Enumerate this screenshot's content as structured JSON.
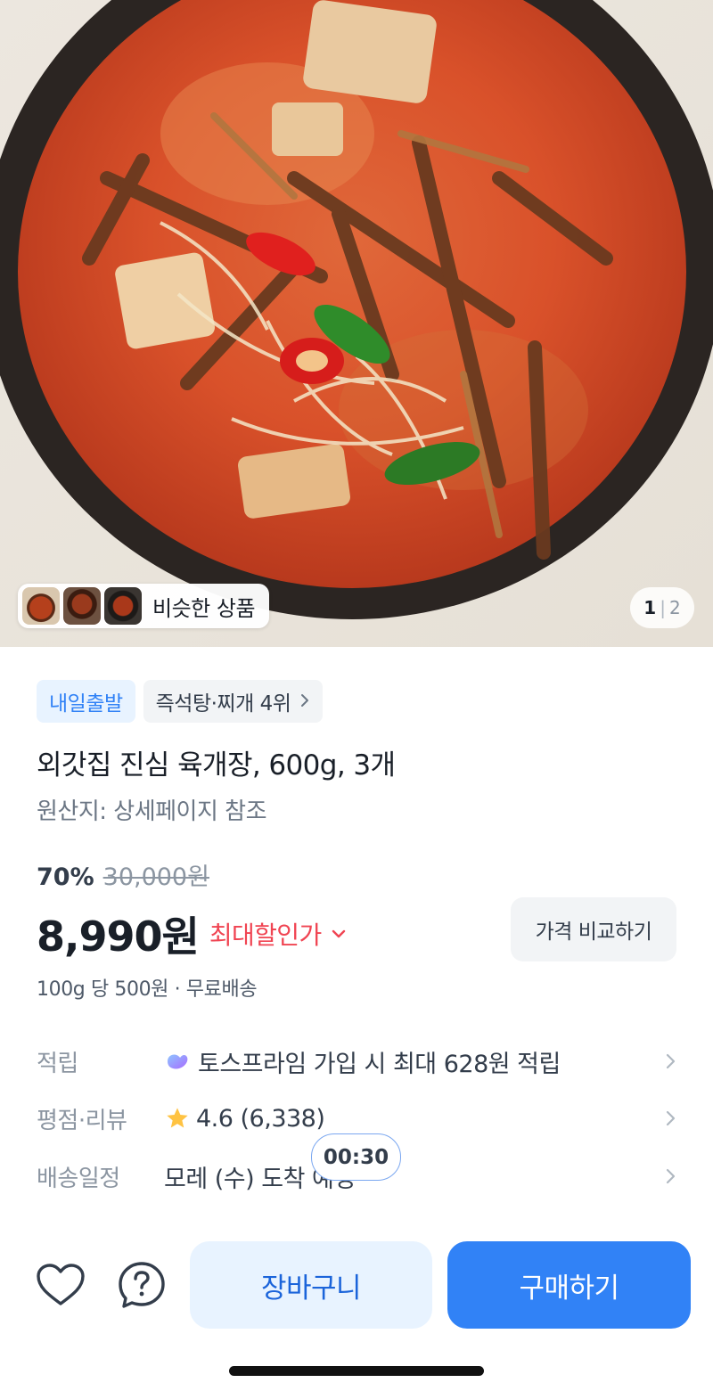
{
  "hero": {
    "image_icon": "food-photo",
    "similar_label": "비슷한 상품",
    "pager_current": "1",
    "pager_separator": "|",
    "pager_total": "2"
  },
  "tags": {
    "delivery": "내일출발",
    "rank": "즉석탕·찌개 4위",
    "rank_icon": "chevron-right-icon"
  },
  "product": {
    "title": "외갓집 진심 육개장, 600g, 3개",
    "origin": "원산지: 상세페이지 참조"
  },
  "pricing": {
    "discount": "70%",
    "original_price": "30,000원",
    "price": "8,990원",
    "max_discount_label": "최대할인가",
    "compare_label": "가격 비교하기",
    "unit_price": "100g 당 500원 · 무료배송"
  },
  "info": {
    "points_label": "적립",
    "points_value": "토스프라임 가입 시 최대 628원 적립",
    "rating_label": "평점·리뷰",
    "rating_value": "4.6 (6,338)",
    "shipping_label": "배송일정",
    "shipping_value": "모레 (수) 도착 예정"
  },
  "timer": "00:30",
  "bottom": {
    "cart_label": "장바구니",
    "buy_label": "구매하기"
  },
  "colors": {
    "accent": "#3182f6",
    "discount_red": "#f04452",
    "star": "#ffc342"
  }
}
